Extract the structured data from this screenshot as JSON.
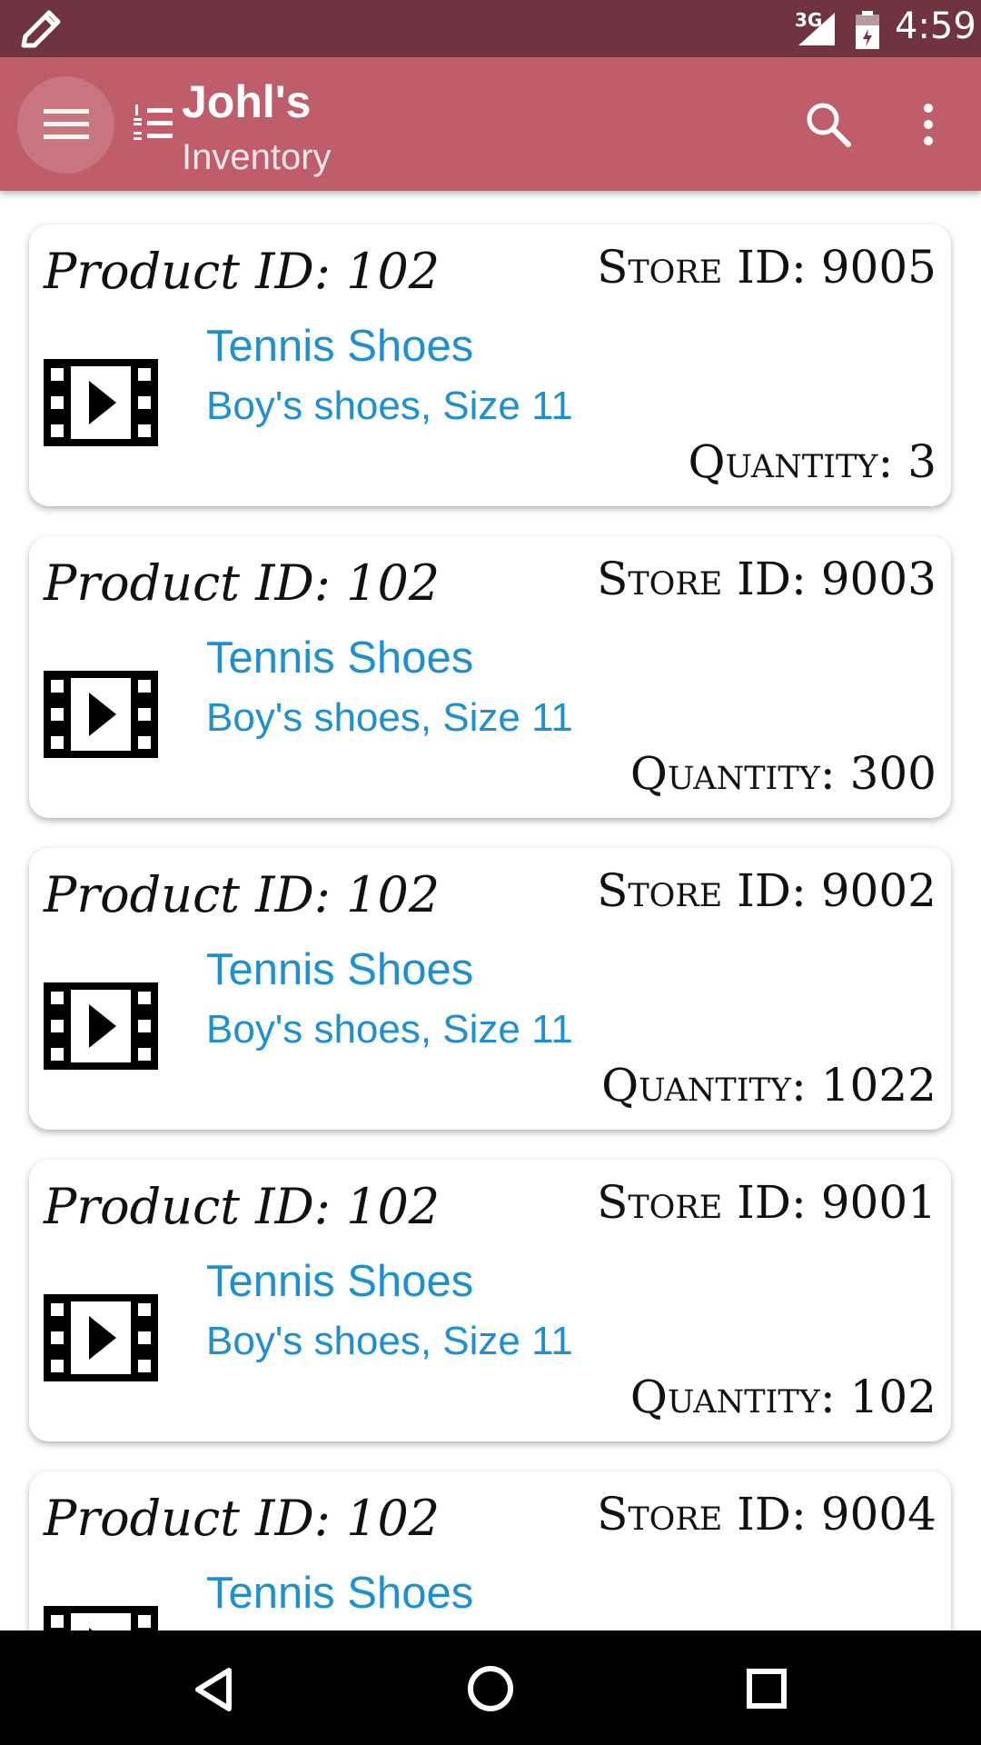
{
  "status_bar": {
    "network": "3G",
    "time": "4:59"
  },
  "app_bar": {
    "title": "Johl's",
    "subtitle": "Inventory"
  },
  "colors": {
    "status_bar": "#6f3440",
    "app_bar": "#bf5d6a",
    "accent_text": "#1e90d0"
  },
  "icons": {
    "status": [
      "pencil-icon",
      "signal-icon",
      "battery-icon"
    ],
    "app_bar": [
      "hamburger-menu-icon",
      "numbered-list-icon",
      "search-icon",
      "more-vert-icon"
    ],
    "card": "film-icon",
    "nav": [
      "back-icon",
      "home-icon",
      "recents-icon"
    ]
  },
  "items": [
    {
      "product_label": "Product ID: 102",
      "store_label": "Store ID: 9005",
      "name": "Tennis Shoes",
      "description": "Boy's shoes, Size 11",
      "quantity_label": "Quantity: 3"
    },
    {
      "product_label": "Product ID: 102",
      "store_label": "Store ID: 9003",
      "name": "Tennis Shoes",
      "description": "Boy's shoes, Size 11",
      "quantity_label": "Quantity: 300"
    },
    {
      "product_label": "Product ID: 102",
      "store_label": "Store ID: 9002",
      "name": "Tennis Shoes",
      "description": "Boy's shoes, Size 11",
      "quantity_label": "Quantity: 1022"
    },
    {
      "product_label": "Product ID: 102",
      "store_label": "Store ID: 9001",
      "name": "Tennis Shoes",
      "description": "Boy's shoes, Size 11",
      "quantity_label": "Quantity: 102"
    },
    {
      "product_label": "Product ID: 102",
      "store_label": "Store ID: 9004",
      "name": "Tennis Shoes",
      "description": "",
      "quantity_label": ""
    }
  ]
}
